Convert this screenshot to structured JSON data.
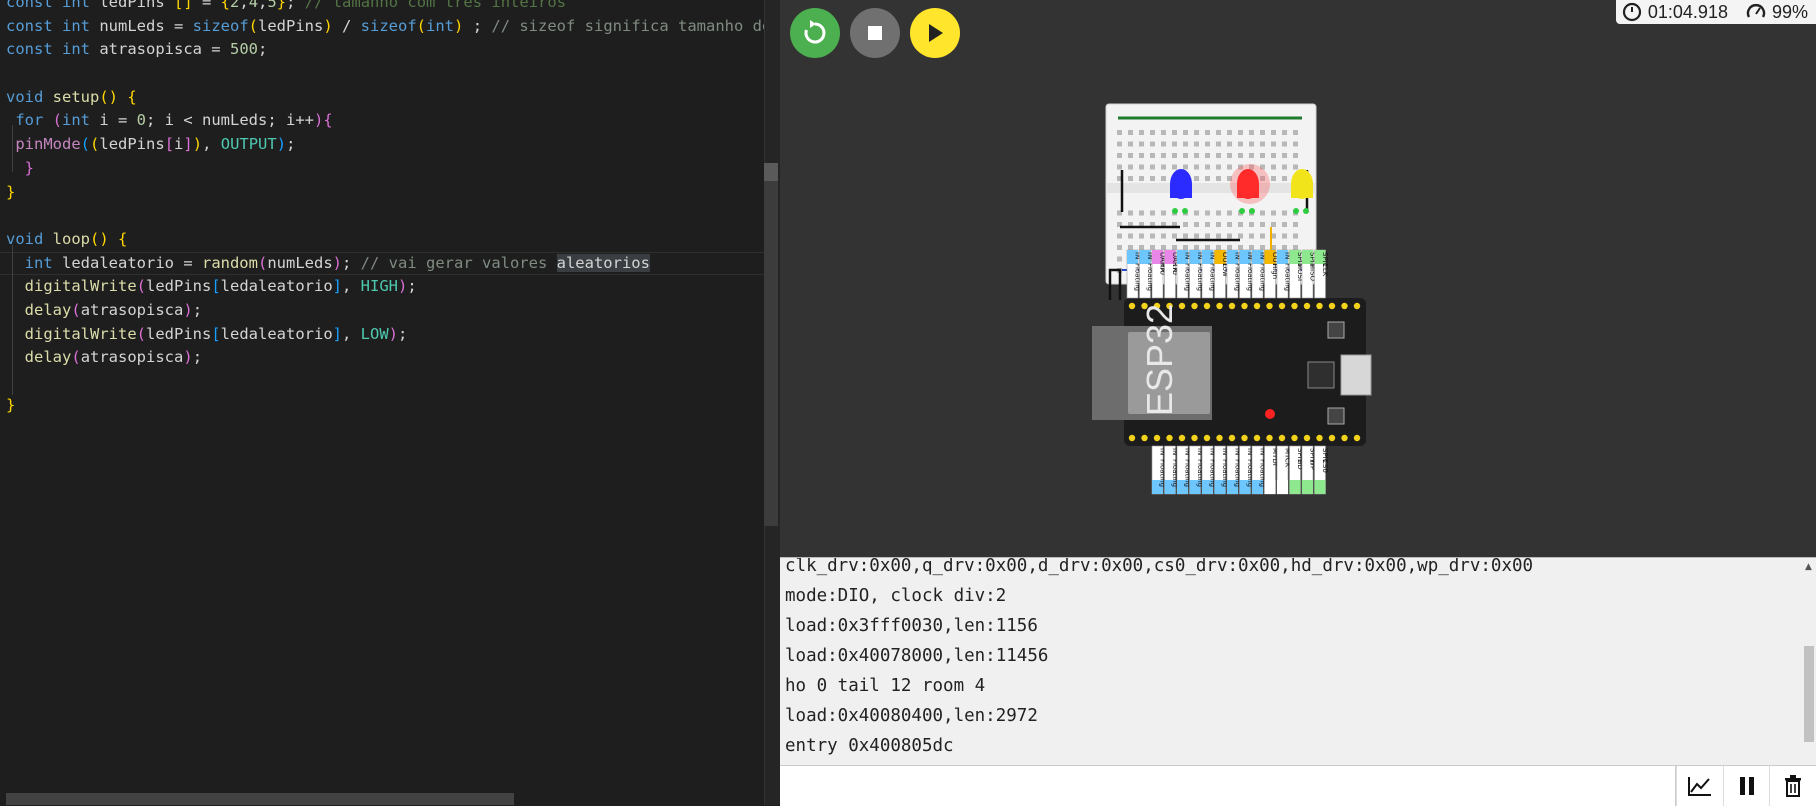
{
  "editor": {
    "lines": [
      [
        [
          "kw",
          "const "
        ],
        [
          "kw",
          "int "
        ],
        [
          "var",
          "ledPins "
        ],
        [
          "b1",
          "[] "
        ],
        [
          "var",
          "= "
        ],
        [
          "b1",
          "{"
        ],
        [
          "num",
          "2"
        ],
        [
          "var",
          ","
        ],
        [
          "num",
          "4"
        ],
        [
          "var",
          ","
        ],
        [
          "num",
          "5"
        ],
        [
          "b1",
          "}"
        ],
        [
          "var",
          "; "
        ],
        [
          "cmt",
          "// tamanho com tres inteiros"
        ]
      ],
      [
        [
          "kw",
          "const "
        ],
        [
          "kw",
          "int "
        ],
        [
          "var",
          "numLeds = "
        ],
        [
          "kw",
          "sizeof"
        ],
        [
          "b1",
          "("
        ],
        [
          "var",
          "ledPins"
        ],
        [
          "b1",
          ") "
        ],
        [
          "var",
          "/ "
        ],
        [
          "kw",
          "sizeof"
        ],
        [
          "b1",
          "("
        ],
        [
          "kw",
          "int"
        ],
        [
          "b1",
          ") "
        ],
        [
          "var",
          "; "
        ],
        [
          "cmt2",
          "// sizeof significa tamanho de"
        ]
      ],
      [
        [
          "kw",
          "const "
        ],
        [
          "kw",
          "int "
        ],
        [
          "var",
          "atrasopisca = "
        ],
        [
          "num",
          "500"
        ],
        [
          "var",
          ";"
        ]
      ],
      [
        [
          "var",
          " "
        ]
      ],
      [
        [
          "kw",
          "void "
        ],
        [
          "fn",
          "setup"
        ],
        [
          "b1",
          "() {"
        ]
      ],
      [
        [
          "var",
          " "
        ],
        [
          "kw",
          "for "
        ],
        [
          "b2",
          "("
        ],
        [
          "kw",
          "int "
        ],
        [
          "var",
          "i = "
        ],
        [
          "num",
          "0"
        ],
        [
          "var",
          "; i < numLeds; i++"
        ],
        [
          "b2",
          ")"
        ],
        [
          "b2",
          "{"
        ]
      ],
      [
        [
          "var",
          " "
        ],
        [
          "fn2",
          "pinMode"
        ],
        [
          "b3",
          "("
        ],
        [
          "b1",
          "("
        ],
        [
          "var",
          "ledPins"
        ],
        [
          "b2",
          "["
        ],
        [
          "var",
          "i"
        ],
        [
          "b2",
          "]"
        ],
        [
          "b1",
          ")"
        ],
        [
          "var",
          ", "
        ],
        [
          "cst",
          "OUTPUT"
        ],
        [
          "b3",
          ")"
        ],
        [
          "var",
          ";"
        ]
      ],
      [
        [
          "var",
          "  "
        ],
        [
          "b2",
          "}"
        ]
      ],
      [
        [
          "b1",
          "}"
        ]
      ],
      [
        [
          "var",
          " "
        ]
      ],
      [
        [
          "kw",
          "void "
        ],
        [
          "fn",
          "loop"
        ],
        [
          "b1",
          "() {"
        ]
      ],
      [
        [
          "var",
          "  "
        ],
        [
          "kw",
          "int "
        ],
        [
          "var",
          "ledaleatorio = "
        ],
        [
          "fn",
          "random"
        ],
        [
          "b2",
          "("
        ],
        [
          "var",
          "numLeds"
        ],
        [
          "b2",
          ")"
        ],
        [
          "var",
          "; "
        ],
        [
          "cmt2",
          "// vai gerar valores "
        ],
        [
          "hl",
          "aleatorios"
        ]
      ],
      [
        [
          "var",
          "  "
        ],
        [
          "fn",
          "digitalWrite"
        ],
        [
          "b2",
          "("
        ],
        [
          "var",
          "ledPins"
        ],
        [
          "b3",
          "["
        ],
        [
          "var",
          "ledaleatorio"
        ],
        [
          "b3",
          "]"
        ],
        [
          "var",
          ", "
        ],
        [
          "cst",
          "HIGH"
        ],
        [
          "b2",
          ")"
        ],
        [
          "var",
          ";"
        ]
      ],
      [
        [
          "var",
          "  "
        ],
        [
          "fn",
          "delay"
        ],
        [
          "b2",
          "("
        ],
        [
          "var",
          "atrasopisca"
        ],
        [
          "b2",
          ")"
        ],
        [
          "var",
          ";"
        ]
      ],
      [
        [
          "var",
          "  "
        ],
        [
          "fn",
          "digitalWrite"
        ],
        [
          "b2",
          "("
        ],
        [
          "var",
          "ledPins"
        ],
        [
          "b3",
          "["
        ],
        [
          "var",
          "ledaleatorio"
        ],
        [
          "b3",
          "]"
        ],
        [
          "var",
          ", "
        ],
        [
          "cst",
          "LOW"
        ],
        [
          "b2",
          ")"
        ],
        [
          "var",
          ";"
        ]
      ],
      [
        [
          "var",
          "  "
        ],
        [
          "fn",
          "delay"
        ],
        [
          "b2",
          "("
        ],
        [
          "var",
          "atrasopisca"
        ],
        [
          "b2",
          ")"
        ],
        [
          "var",
          ";"
        ]
      ],
      [
        [
          "var",
          " "
        ]
      ],
      [
        [
          "b1",
          "}"
        ]
      ]
    ]
  },
  "toolbar": {
    "restart_icon": "restart-icon",
    "stop_icon": "stop-icon",
    "play_icon": "play-icon",
    "timer": "01:04.918",
    "cpu": "99%"
  },
  "colors": {
    "restart": "#4caf50",
    "stop": "#707070",
    "play": "#ffe52b",
    "led_blue": "#2b2bff",
    "led_red": "#ff2b2b",
    "led_yellow": "#f2e41a"
  },
  "board": {
    "chip_label": "ESP32",
    "top_pins": [
      "IN",
      "IN",
      "UART0",
      "UART0",
      "IN",
      "IN",
      "IN",
      "OUT",
      "IN",
      "IN",
      "IN",
      "OUT",
      "IN",
      "SPI1",
      "SPI1",
      "SPI1"
    ],
    "top_pins_sub": [
      "Floating",
      "Floating",
      "RX",
      "TX",
      "Floating",
      "Floating",
      "Floating",
      "Low",
      "Floating",
      "Floating",
      "Floating",
      "High",
      "Floating",
      "MOSI",
      "MISO",
      "CLK"
    ],
    "bottom_pins": [
      "IN",
      "IN",
      "IN",
      "IN",
      "IN",
      "IN",
      "IN",
      "IN",
      "IN",
      "MTDI",
      "MTCK",
      "SPI1",
      "SPI1",
      "SPI1"
    ],
    "bottom_pins_sub": [
      "Floating",
      "Floating",
      "Floating",
      "Floating",
      "Floating",
      "Floating",
      "Floating",
      "Floating",
      "Floating",
      "",
      "",
      "HD",
      "WP",
      "CS0"
    ]
  },
  "serial": {
    "lines": [
      "clk_drv:0x00,q_drv:0x00,d_drv:0x00,cs0_drv:0x00,hd_drv:0x00,wp_drv:0x00",
      "mode:DIO, clock div:2",
      "load:0x3fff0030,len:1156",
      "load:0x40078000,len:11456",
      "ho 0 tail 12 room 4",
      "load:0x40080400,len:2972",
      "entry 0x400805dc"
    ],
    "input_placeholder": "",
    "tools": [
      "chart-icon",
      "pause-icon",
      "trash-icon"
    ]
  }
}
